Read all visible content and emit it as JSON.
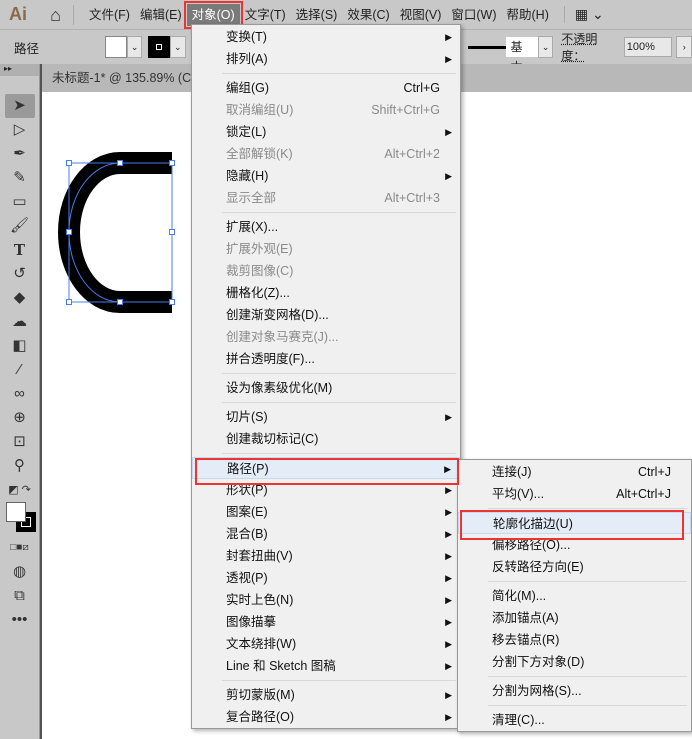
{
  "menubar": {
    "logo": "Ai",
    "items": [
      "文件(F)",
      "编辑(E)",
      "对象(O)",
      "文字(T)",
      "选择(S)",
      "效果(C)",
      "视图(V)",
      "窗口(W)",
      "帮助(H)"
    ]
  },
  "control": {
    "label": "路径",
    "stroke_style": "基本",
    "opacity_label": "不透明度：",
    "opacity_value": "100%"
  },
  "document": {
    "tab_title": "未标题-1* @ 135.89% (C"
  },
  "object_menu": {
    "items": [
      {
        "label": "变换(T)",
        "sub": true
      },
      {
        "label": "排列(A)",
        "sub": true
      },
      {
        "sep": true
      },
      {
        "label": "编组(G)",
        "shortcut": "Ctrl+G"
      },
      {
        "label": "取消编组(U)",
        "shortcut": "Shift+Ctrl+G",
        "disabled": true
      },
      {
        "label": "锁定(L)",
        "sub": true
      },
      {
        "label": "全部解锁(K)",
        "shortcut": "Alt+Ctrl+2",
        "disabled": true
      },
      {
        "label": "隐藏(H)",
        "sub": true
      },
      {
        "label": "显示全部",
        "shortcut": "Alt+Ctrl+3",
        "disabled": true
      },
      {
        "sep": true
      },
      {
        "label": "扩展(X)..."
      },
      {
        "label": "扩展外观(E)",
        "disabled": true
      },
      {
        "label": "裁剪图像(C)",
        "disabled": true
      },
      {
        "label": "栅格化(Z)..."
      },
      {
        "label": "创建渐变网格(D)..."
      },
      {
        "label": "创建对象马赛克(J)...",
        "disabled": true
      },
      {
        "label": "拼合透明度(F)..."
      },
      {
        "sep": true
      },
      {
        "label": "设为像素级优化(M)"
      },
      {
        "sep": true
      },
      {
        "label": "切片(S)",
        "sub": true
      },
      {
        "label": "创建裁切标记(C)"
      },
      {
        "sep": true
      },
      {
        "label": "路径(P)",
        "sub": true,
        "highlight": true
      },
      {
        "label": "形状(P)",
        "sub": true
      },
      {
        "label": "图案(E)",
        "sub": true
      },
      {
        "label": "混合(B)",
        "sub": true
      },
      {
        "label": "封套扭曲(V)",
        "sub": true
      },
      {
        "label": "透视(P)",
        "sub": true
      },
      {
        "label": "实时上色(N)",
        "sub": true
      },
      {
        "label": "图像描摹",
        "sub": true
      },
      {
        "label": "文本绕排(W)",
        "sub": true
      },
      {
        "label": "Line 和 Sketch 图稿",
        "sub": true
      },
      {
        "sep": true
      },
      {
        "label": "剪切蒙版(M)",
        "sub": true
      },
      {
        "label": "复合路径(O)",
        "sub": true
      }
    ]
  },
  "path_submenu": {
    "items": [
      {
        "label": "连接(J)",
        "shortcut": "Ctrl+J"
      },
      {
        "label": "平均(V)...",
        "shortcut": "Alt+Ctrl+J"
      },
      {
        "sep": true
      },
      {
        "label": "轮廓化描边(U)",
        "highlight": true
      },
      {
        "label": "偏移路径(O)..."
      },
      {
        "label": "反转路径方向(E)"
      },
      {
        "sep": true
      },
      {
        "label": "简化(M)..."
      },
      {
        "label": "添加锚点(A)"
      },
      {
        "label": "移去锚点(R)"
      },
      {
        "label": "分割下方对象(D)"
      },
      {
        "sep": true
      },
      {
        "label": "分割为网格(S)..."
      },
      {
        "sep": true
      },
      {
        "label": "清理(C)..."
      }
    ]
  }
}
